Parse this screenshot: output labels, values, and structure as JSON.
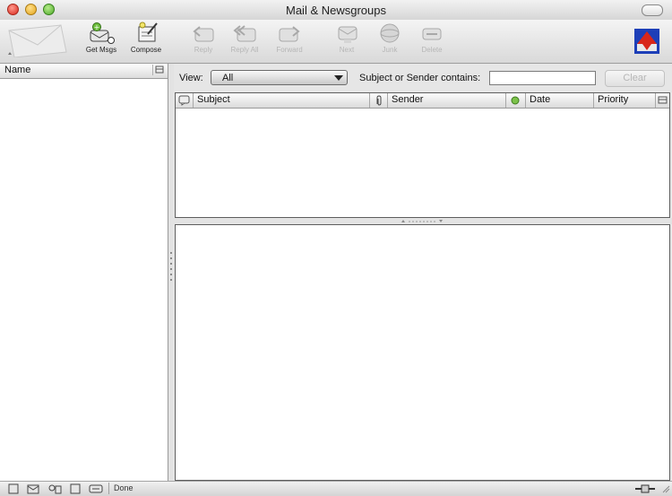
{
  "window": {
    "title": "Mail & Newsgroups"
  },
  "toolbar": {
    "buttons": [
      {
        "label": "Get Msgs",
        "icon": "get-messages-icon",
        "enabled": true
      },
      {
        "label": "Compose",
        "icon": "compose-icon",
        "enabled": true
      },
      {
        "label": "Reply",
        "icon": "reply-icon",
        "enabled": false
      },
      {
        "label": "Reply All",
        "icon": "reply-all-icon",
        "enabled": false
      },
      {
        "label": "Forward",
        "icon": "forward-icon",
        "enabled": false
      },
      {
        "label": "Next",
        "icon": "next-icon",
        "enabled": false
      },
      {
        "label": "Junk",
        "icon": "junk-icon",
        "enabled": false
      },
      {
        "label": "Delete",
        "icon": "delete-icon",
        "enabled": false
      }
    ]
  },
  "folders": {
    "column_label": "Name"
  },
  "filter": {
    "view_label": "View:",
    "view_value": "All",
    "search_label": "Subject or Sender contains:",
    "search_value": "",
    "clear_label": "Clear"
  },
  "thread_columns": [
    "Subject",
    "Sender",
    "Date",
    "Priority"
  ],
  "status": {
    "text": "Done"
  },
  "colors": {
    "brand_red": "#d8261a",
    "brand_blue": "#1d3fb8"
  }
}
